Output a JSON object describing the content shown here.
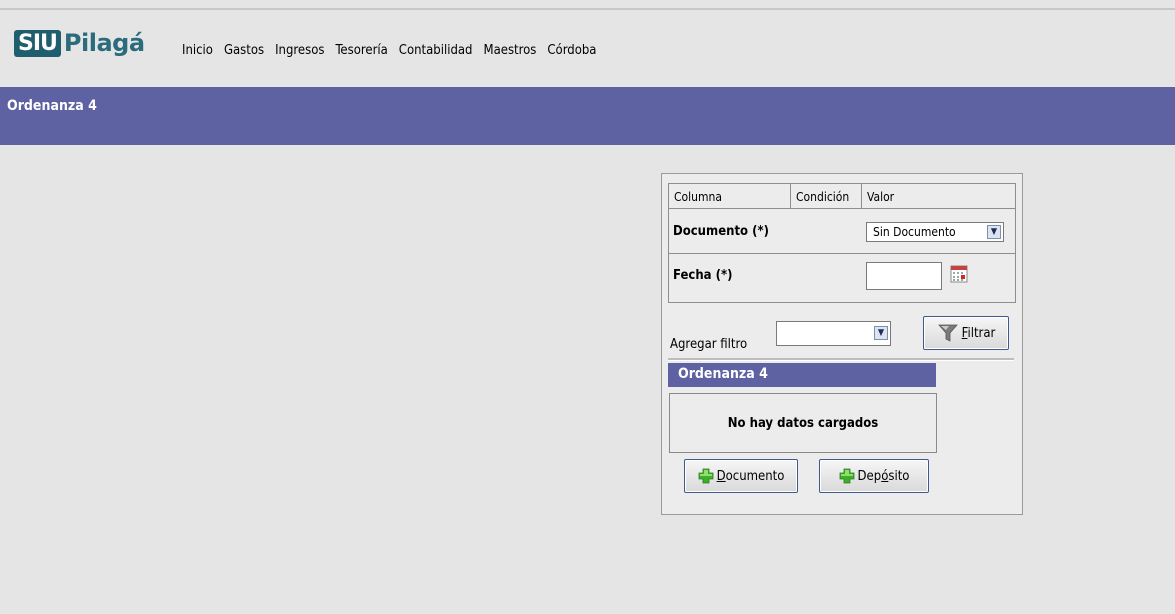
{
  "logo": {
    "siu": "SIU",
    "pilaga": "Pilagá"
  },
  "menu": {
    "items": [
      "Inicio",
      "Gastos",
      "Ingresos",
      "Tesorería",
      "Contabilidad",
      "Maestros",
      "Córdoba"
    ]
  },
  "page_title": "Ordenanza 4",
  "filter": {
    "headers": {
      "columna": "Columna",
      "condicion": "Condición",
      "valor": "Valor"
    },
    "rows": [
      {
        "label": "Documento (*)",
        "value": "Sin Documento"
      },
      {
        "label": "Fecha (*)",
        "value": ""
      }
    ],
    "agregar_label": "Agregar filtro",
    "agregar_value": "",
    "filtrar_button": {
      "first": "F",
      "rest": "iltrar"
    }
  },
  "cuadro": {
    "title": "Ordenanza 4",
    "empty_message": "No hay datos cargados"
  },
  "buttons": {
    "documento": {
      "first": "D",
      "rest": "ocumento"
    },
    "deposito": {
      "pre": "Dep",
      "ul": "ó",
      "post": "sito"
    }
  },
  "colors": {
    "titlebar": "#5f62a2",
    "logo": "#1f5e6e"
  }
}
